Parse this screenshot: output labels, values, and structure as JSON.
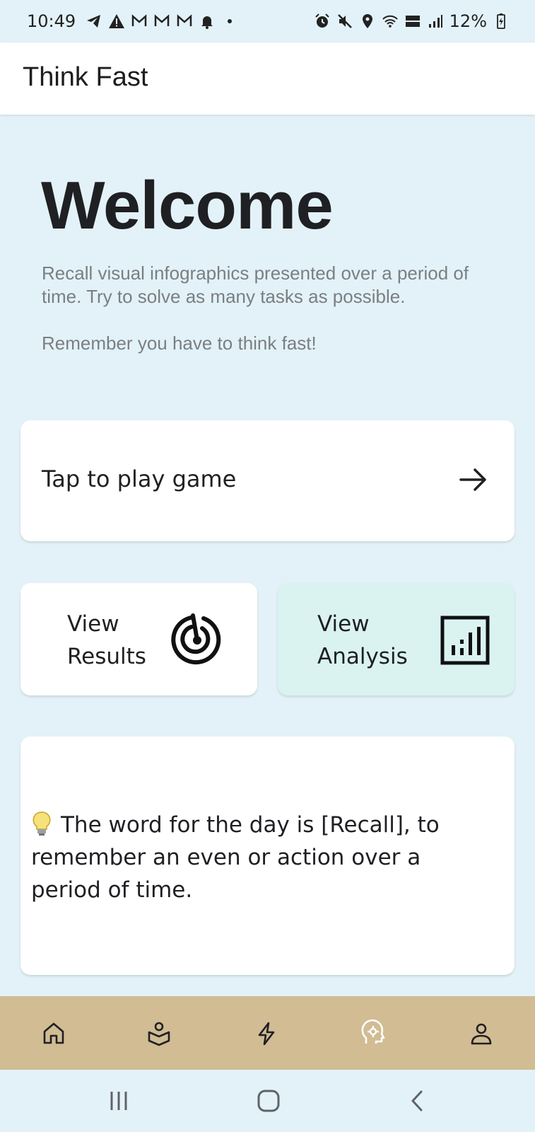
{
  "status_bar": {
    "time": "10:49",
    "battery": "12%",
    "left_icons": [
      "telegram-icon",
      "warning-icon",
      "gmail-icon",
      "gmail-icon",
      "gmail-icon",
      "notification-bell-icon",
      "dot-icon"
    ],
    "right_icons": [
      "alarm-icon",
      "mute-icon",
      "location-icon",
      "wifi-icon",
      "volte-icon",
      "signal-icon",
      "battery-charging-icon"
    ]
  },
  "app_bar": {
    "title": "Think Fast"
  },
  "welcome": {
    "heading": "Welcome",
    "description": "Recall visual infographics presented over a period of time. Try to solve as many tasks as possible.",
    "reminder": "Remember you have to think fast!"
  },
  "play_card": {
    "label": "Tap to play game",
    "icon": "arrow-right-icon"
  },
  "tiles": {
    "results": {
      "line1": "View",
      "line2": "Results",
      "icon": "target-icon"
    },
    "analysis": {
      "line1": "View",
      "line2": "Analysis",
      "icon": "bar-chart-icon"
    }
  },
  "word_card": {
    "icon": "lightbulb-icon",
    "text": "The word for the day is [Recall], to remember an even or action over a period of time."
  },
  "bottom_nav": {
    "items": [
      "home-icon",
      "learn-icon",
      "lightning-icon",
      "brain-icon",
      "profile-icon"
    ]
  },
  "system_nav": {
    "items": [
      "recent-apps-icon",
      "home-button-icon",
      "back-icon"
    ]
  },
  "colors": {
    "background": "#e3f2f8",
    "card": "#ffffff",
    "analysis_card": "#daf3f1",
    "bottom_nav": "#d1bc93",
    "muted_text": "#7a7f82"
  }
}
